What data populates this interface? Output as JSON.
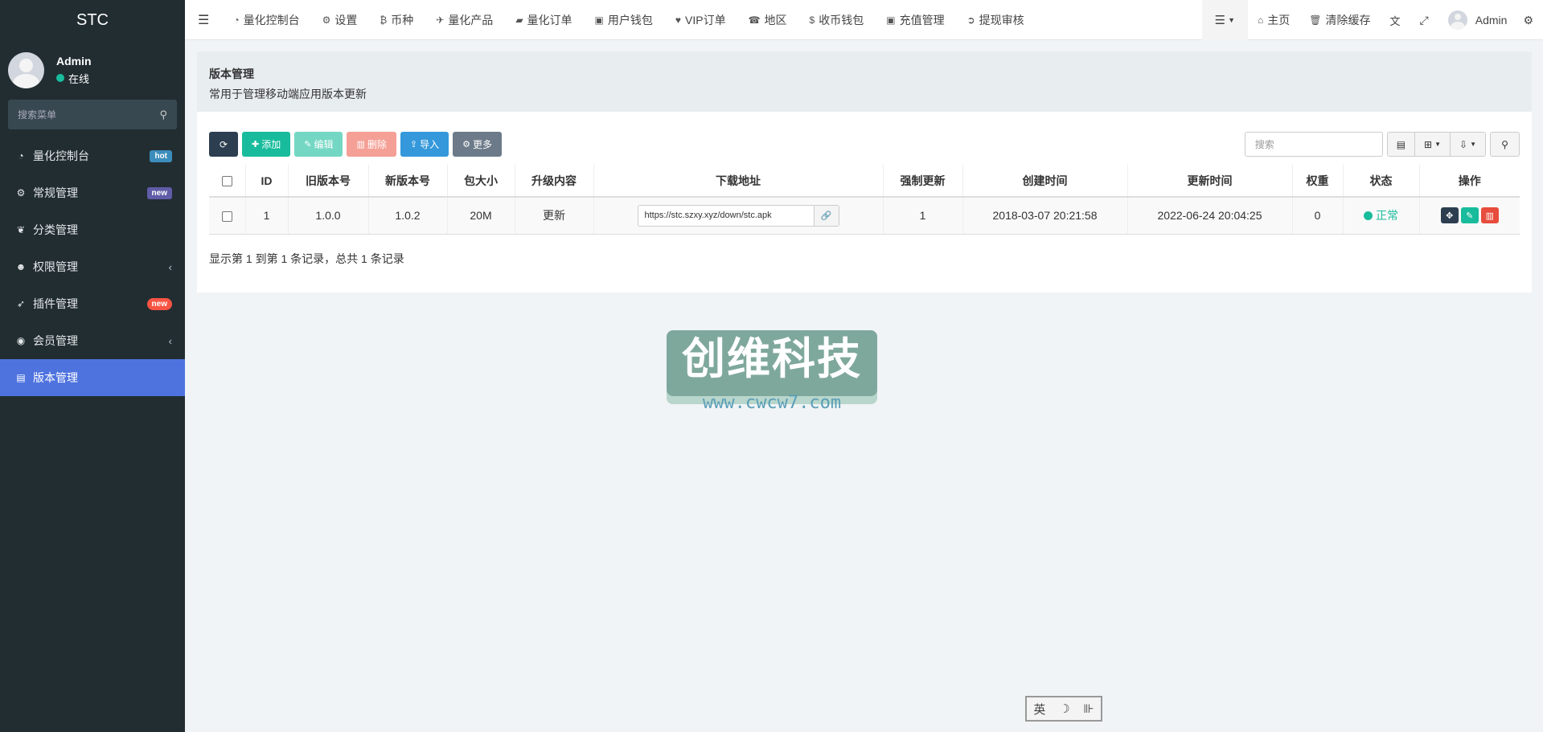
{
  "brand": "STC",
  "user": {
    "name": "Admin",
    "status": "在线"
  },
  "sidebar": {
    "search_placeholder": "搜索菜单",
    "items": [
      {
        "label": "量化控制台",
        "badge": "hot"
      },
      {
        "label": "常规管理",
        "badge": "new"
      },
      {
        "label": "分类管理"
      },
      {
        "label": "权限管理",
        "chevron": "‹"
      },
      {
        "label": "插件管理",
        "badge": "new"
      },
      {
        "label": "会员管理",
        "chevron": "‹"
      },
      {
        "label": "版本管理"
      }
    ]
  },
  "topnav": {
    "items": [
      "量化控制台",
      "设置",
      "币种",
      "量化产品",
      "量化订单",
      "用户钱包",
      "VIP订单",
      "地区",
      "收币钱包",
      "充值管理",
      "提现审核"
    ],
    "home": "主页",
    "clear_cache": "清除缓存",
    "admin": "Admin"
  },
  "panel": {
    "title": "版本管理",
    "desc": "常用于管理移动端应用版本更新"
  },
  "toolbar": {
    "add": "添加",
    "edit": "编辑",
    "delete": "删除",
    "import": "导入",
    "more": "更多",
    "search_placeholder": "搜索"
  },
  "table": {
    "headers": [
      "ID",
      "旧版本号",
      "新版本号",
      "包大小",
      "升级内容",
      "下载地址",
      "强制更新",
      "创建时间",
      "更新时间",
      "权重",
      "状态",
      "操作"
    ],
    "rows": [
      {
        "id": "1",
        "old": "1.0.0",
        "new": "1.0.2",
        "size": "20M",
        "content": "更新",
        "url": "https://stc.szxy.xyz/down/stc.apk",
        "force": "1",
        "created": "2018-03-07 20:21:58",
        "updated": "2022-06-24 20:04:25",
        "weight": "0",
        "status": "正常"
      }
    ]
  },
  "pagination": "显示第 1 到第 1 条记录，总共 1 条记录",
  "watermark": {
    "title": "创维科技",
    "url": "www.cwcw7.com"
  },
  "ime": {
    "mode": "英",
    "moon": "☽",
    "sep": "⊪"
  }
}
